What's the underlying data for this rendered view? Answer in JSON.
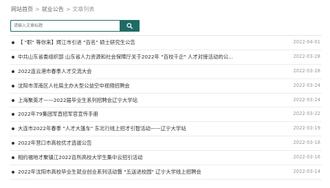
{
  "breadcrumb": {
    "home": "网站首页",
    "section": "就业公告",
    "current": "文章列表",
    "separator": ">"
  },
  "search": {
    "placeholder": "请输入文章标题",
    "button_icon": "search-icon"
  },
  "colors": {
    "accent": "#1f6b64"
  },
  "articles": [
    {
      "title": "【 \"职\" 等你来】辉江市引进 \"百名\" 硕士研究生公告",
      "date": "2022-04-01"
    },
    {
      "title": "中共山东省委组织部 山东省人力资源和社会保障厅关于2022年 \"百校千企\" 人才对接活动的公...",
      "date": "2022-03-28"
    },
    {
      "title": "2022连云港市春季人才交流大会",
      "date": "2022-03-28"
    },
    {
      "title": "沈阳市浑南区人社局主办大型公益空中视频招聘会",
      "date": "2022-03-24"
    },
    {
      "title": "上海聚英才——2022届毕业生系列招聘会辽宁大学站",
      "date": "2022-03-24"
    },
    {
      "title": "2022年79集团军直招军官宣传手册",
      "date": "2022-03-22"
    },
    {
      "title": "大连市2022年春季 \"人才大篷车\" 东北行线上招才引智活动——辽宁大学站",
      "date": "2022-03-19"
    },
    {
      "title": "2022年营口市高校优才选拔公告",
      "date": "2022-03-18"
    },
    {
      "title": "相约福地才聚镇江2022百所高校大学生集中云招引活动",
      "date": "2022-03-16"
    },
    {
      "title": "2022年沈阳市高校毕业生就业创业系列活动暨 \"五送进校园\" 辽宁大学线上招聘会",
      "date": "2022-03-14"
    }
  ]
}
